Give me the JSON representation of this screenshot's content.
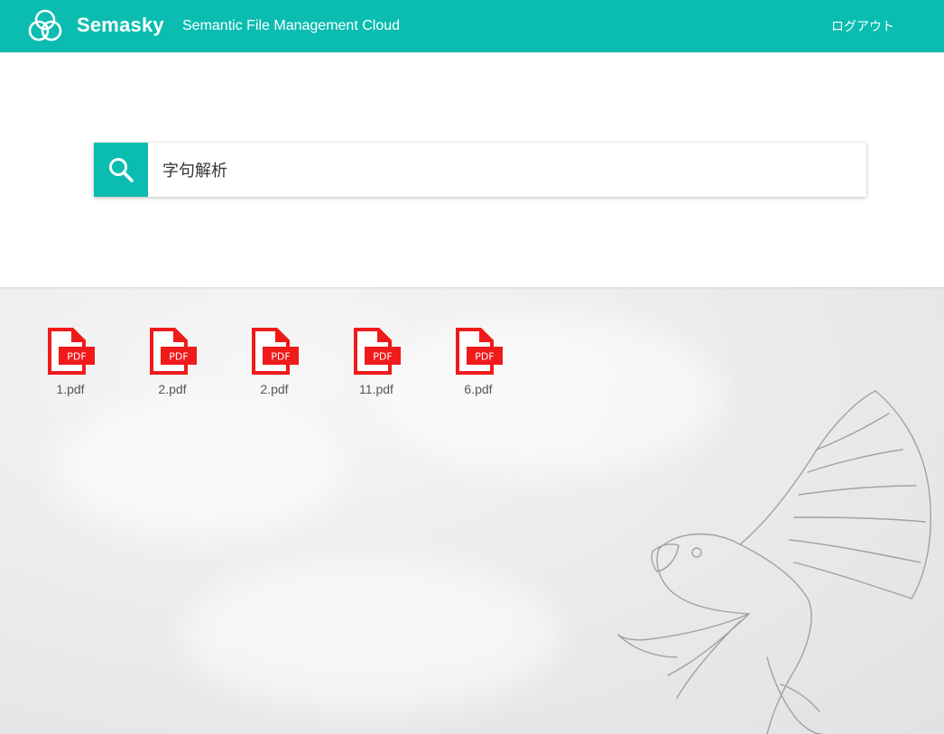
{
  "header": {
    "brand": "Semasky",
    "tagline": "Semantic File Management Cloud",
    "logout_label": "ログアウト",
    "accent_color": "#0abdb0"
  },
  "search": {
    "value": "字句解析",
    "icon": "search-icon"
  },
  "files": [
    {
      "name": "1.pdf",
      "type": "PDF",
      "icon": "pdf-file-icon"
    },
    {
      "name": "2.pdf",
      "type": "PDF",
      "icon": "pdf-file-icon"
    },
    {
      "name": "2.pdf",
      "type": "PDF",
      "icon": "pdf-file-icon"
    },
    {
      "name": "11.pdf",
      "type": "PDF",
      "icon": "pdf-file-icon"
    },
    {
      "name": "6.pdf",
      "type": "PDF",
      "icon": "pdf-file-icon"
    }
  ],
  "pdf_icon_color": "#f01a1a"
}
